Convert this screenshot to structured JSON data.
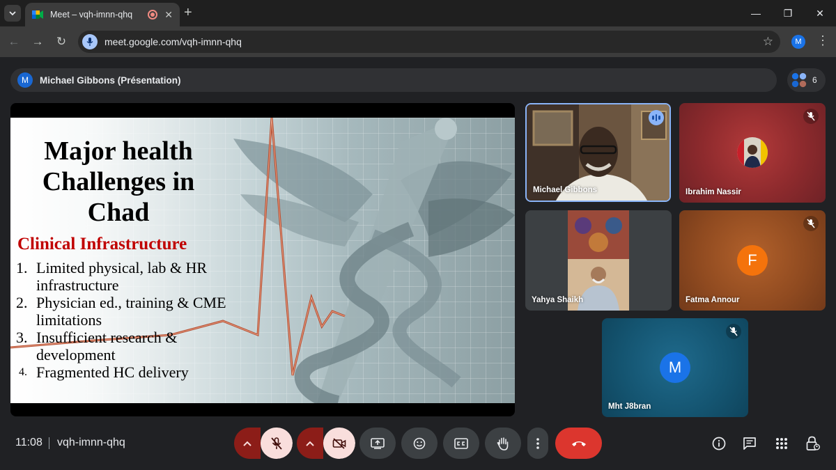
{
  "browser": {
    "tab_title": "Meet – vqh-imnn-qhq",
    "url": "meet.google.com/vqh-imnn-qhq",
    "profile_initial": "M"
  },
  "meet": {
    "presenting_label": "Michael Gibbons (Présentation)",
    "presenter_initial": "M",
    "participant_count": "6",
    "time": "11:08",
    "meeting_code": "vqh-imnn-qhq"
  },
  "slide": {
    "title": "Major health Challenges in Chad",
    "subtitle": "Clinical Infrastructure",
    "items": [
      {
        "num": "1.",
        "text": "Limited physical, lab & HR infrastructure"
      },
      {
        "num": "2.",
        "text": "Physician ed., training & CME limitations"
      },
      {
        "num": "3.",
        "text": "Insufficient  research & development"
      },
      {
        "num": "4.",
        "text": "Fragmented HC delivery"
      }
    ]
  },
  "participants": [
    {
      "name": "Michael Gibbons",
      "state": "speaking"
    },
    {
      "name": "Ibrahim Nassir",
      "state": "muted"
    },
    {
      "name": "Yahya Shaikh",
      "state": "video"
    },
    {
      "name": "Fatma Annour",
      "state": "muted",
      "initial": "F",
      "avatar_color": "#f4730c"
    },
    {
      "name": "Mht J8bran",
      "state": "muted",
      "initial": "M",
      "avatar_color": "#1a73e8"
    }
  ],
  "colors": {
    "accent": "#8ab4f8",
    "hangup": "#dc362e",
    "mute_active": "#f9dedc",
    "slide_subtitle": "#c00000"
  }
}
